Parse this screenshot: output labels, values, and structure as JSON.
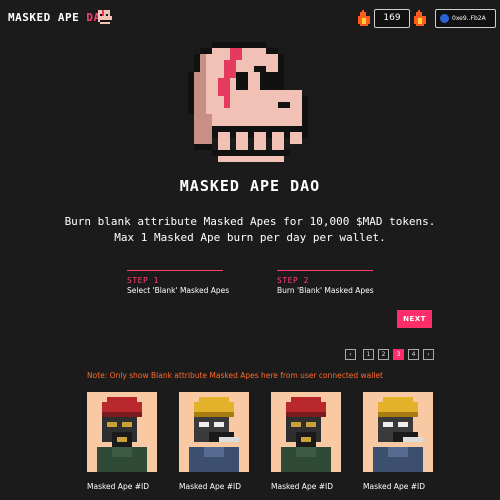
{
  "header": {
    "brand_main": "MASKED APE ",
    "brand_accent": "DAO",
    "token_count": "169",
    "wallet_address": "0xe9..Fb2A",
    "icons": [
      "skull-logo-icon",
      "fire-icon",
      "fire-icon",
      "wallet-icon"
    ]
  },
  "hero": {
    "title": "MASKED APE DAO",
    "line1": "Burn blank attribute Masked Apes for 10,000 $MAD tokens.",
    "line2": "Max 1 Masked Ape burn per day per wallet."
  },
  "steps": [
    {
      "label": "STEP 1",
      "text": "Select 'Blank' Masked Apes"
    },
    {
      "label": "STEP 2",
      "text": "Burn 'Blank' Masked Apes"
    }
  ],
  "next_label": "NEXT",
  "pagination": {
    "prev": "‹",
    "pages": [
      "1",
      "2",
      "3",
      "4"
    ],
    "active": "3",
    "next": "›"
  },
  "note": "Note: Only show Blank attribute Masked Apes here from user connected wallet",
  "cards": [
    {
      "name": "Masked Ape #ID",
      "hat": "red"
    },
    {
      "name": "Masked Ape #ID",
      "hat": "gold"
    },
    {
      "name": "Masked Ape #ID",
      "hat": "red"
    },
    {
      "name": "Masked Ape #ID",
      "hat": "gold"
    }
  ],
  "colors": {
    "accent": "#ff2d6a",
    "note": "#ff6a2a",
    "background": "#1c1b1c",
    "card_bg": "#f9c9a3"
  }
}
